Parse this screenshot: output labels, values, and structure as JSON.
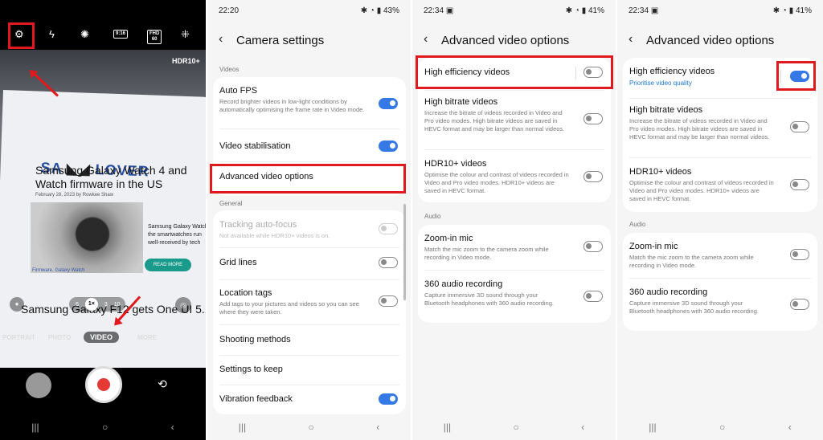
{
  "camera": {
    "top_icons": [
      "gear-icon",
      "flash-icon",
      "timer-icon",
      "aspect-ratio-icon",
      "resolution-icon",
      "effects-icon"
    ],
    "aspect_label": "9:16",
    "resolution_label": "FHD\n60",
    "hdr_label": "HDR10+",
    "site_logo_left": "SA",
    "site_logo_right": "LOVER",
    "article_title": "Samsung Galaxy Watch 4 and Watch firmware in the US",
    "article_date": "February 28, 2023 by Rowkee Shaw",
    "article_side": "Samsung Galaxy Watch the smartwatches run well-received by tech",
    "read_more": "READ MORE",
    "article_cats": "Firmware, Galaxy Watch",
    "article2_title": "Samsung Galaxy F12 gets One UI 5.1",
    "zoom_levels": [
      ".6",
      "1×",
      "3",
      "10"
    ],
    "modes": [
      "PORTRAIT",
      "PHOTO",
      "VIDEO",
      "MORE"
    ]
  },
  "camera_settings": {
    "time": "22:20",
    "battery": "43%",
    "title": "Camera settings",
    "sections": [
      {
        "label": "Videos"
      },
      {
        "label": "General"
      }
    ],
    "items": [
      {
        "title": "Auto FPS",
        "subtitle": "Record brighter videos in low-light conditions by automatically optimising the frame rate in Video mode.",
        "toggle": "on"
      },
      {
        "title": "Video stabilisation",
        "subtitle": "",
        "toggle": "on"
      },
      {
        "title": "Advanced video options",
        "subtitle": "",
        "toggle": "none"
      },
      {
        "title": "Tracking auto-focus",
        "subtitle": "Not available while HDR10+ videos is on.",
        "toggle": "disabled"
      },
      {
        "title": "Grid lines",
        "subtitle": "",
        "toggle": "off"
      },
      {
        "title": "Location tags",
        "subtitle": "Add tags to your pictures and videos so you can see where they were taken.",
        "toggle": "off"
      },
      {
        "title": "Shooting methods",
        "subtitle": "",
        "toggle": "none"
      },
      {
        "title": "Settings to keep",
        "subtitle": "",
        "toggle": "none"
      },
      {
        "title": "Vibration feedback",
        "subtitle": "",
        "toggle": "on"
      }
    ]
  },
  "advanced_a": {
    "time": "22:34",
    "battery": "41%",
    "title": "Advanced video options",
    "items": [
      {
        "title": "High efficiency videos",
        "subtitle": "",
        "toggle": "off"
      },
      {
        "title": "High bitrate videos",
        "subtitle": "Increase the bitrate of videos recorded in Video and Pro video modes. High bitrate videos are saved in HEVC format and may be larger than normal videos.",
        "toggle": "off"
      },
      {
        "title": "HDR10+ videos",
        "subtitle": "Optimise the colour and contrast of videos recorded in Video and Pro video modes. HDR10+ videos are saved in HEVC format.",
        "toggle": "off"
      }
    ],
    "audio_label": "Audio",
    "audio_items": [
      {
        "title": "Zoom-in mic",
        "subtitle": "Match the mic zoom to the camera zoom while recording in Video mode.",
        "toggle": "off"
      },
      {
        "title": "360 audio recording",
        "subtitle": "Capture immersive 3D sound through your Bluetooth headphones with 360 audio recording.",
        "toggle": "off"
      }
    ]
  },
  "advanced_b": {
    "time": "22:34",
    "battery": "41%",
    "title": "Advanced video options",
    "items": [
      {
        "title": "High efficiency videos",
        "subtitle": "Prioritise video quality",
        "toggle": "on"
      },
      {
        "title": "High bitrate videos",
        "subtitle": "Increase the bitrate of videos recorded in Video and Pro video modes. High bitrate videos are saved in HEVC format and may be larger than normal videos.",
        "toggle": "off"
      },
      {
        "title": "HDR10+ videos",
        "subtitle": "Optimise the colour and contrast of videos recorded in Video and Pro video modes. HDR10+ videos are saved in HEVC format.",
        "toggle": "off"
      }
    ],
    "audio_label": "Audio",
    "audio_items": [
      {
        "title": "Zoom-in mic",
        "subtitle": "Match the mic zoom to the camera zoom while recording in Video mode.",
        "toggle": "off"
      },
      {
        "title": "360 audio recording",
        "subtitle": "Capture immersive 3D sound through your Bluetooth headphones with 360 audio recording.",
        "toggle": "off"
      }
    ]
  },
  "nav": {
    "recents": "|||",
    "home": "○",
    "back": "‹"
  },
  "colors": {
    "highlight": "#e0191e",
    "toggle_on": "#3479e6",
    "record": "#e53935"
  }
}
